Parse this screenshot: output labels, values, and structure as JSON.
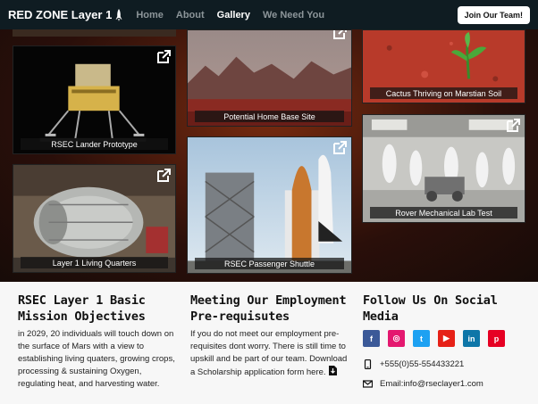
{
  "navbar": {
    "brand": "RED ZONE Layer 1",
    "links": [
      "Home",
      "About",
      "Gallery",
      "We Need You"
    ],
    "cta": "Join Our Team!"
  },
  "gallery": {
    "tiles": [
      {
        "caption": "RSEC Lander Prototype"
      },
      {
        "caption": "Layer 1 Living Quarters"
      },
      {
        "caption": "Potential Home Base Site"
      },
      {
        "caption": "RSEC Passenger Shuttle"
      },
      {
        "caption": "Cactus Thriving on Marstian Soil"
      },
      {
        "caption": "Rover Mechanical Lab Test"
      }
    ]
  },
  "info": {
    "mission": {
      "title": "RSEC Layer 1 Basic Mission Objectives",
      "text": "in 2029, 20 individuals will touch down on the surface of Mars with a view to establishing living quaters, growing crops, processing & sustaining Oxygen, regulating heat, and harvesting water."
    },
    "employment": {
      "title": "Meeting Our Employment Pre-requisutes",
      "text": "If you do not meet our employment pre-requisites dont worry. There is still time to upskill and be part of our team. Download a Scholarship application form here."
    },
    "social": {
      "title": "Follow Us On Social Media",
      "icons": [
        {
          "name": "facebook-icon",
          "glyph": "f",
          "color": "#3b5998"
        },
        {
          "name": "instagram-icon",
          "glyph": "◎",
          "color": "#e4186f"
        },
        {
          "name": "twitter-icon",
          "glyph": "t",
          "color": "#1da1f2"
        },
        {
          "name": "youtube-icon",
          "glyph": "▶",
          "color": "#e62117"
        },
        {
          "name": "linkedin-icon",
          "glyph": "in",
          "color": "#0e76a8"
        },
        {
          "name": "pinterest-icon",
          "glyph": "p",
          "color": "#e60023"
        }
      ],
      "phone": "+555(0)55-554433221",
      "email": "Email:info@rseclayer1.com"
    }
  }
}
